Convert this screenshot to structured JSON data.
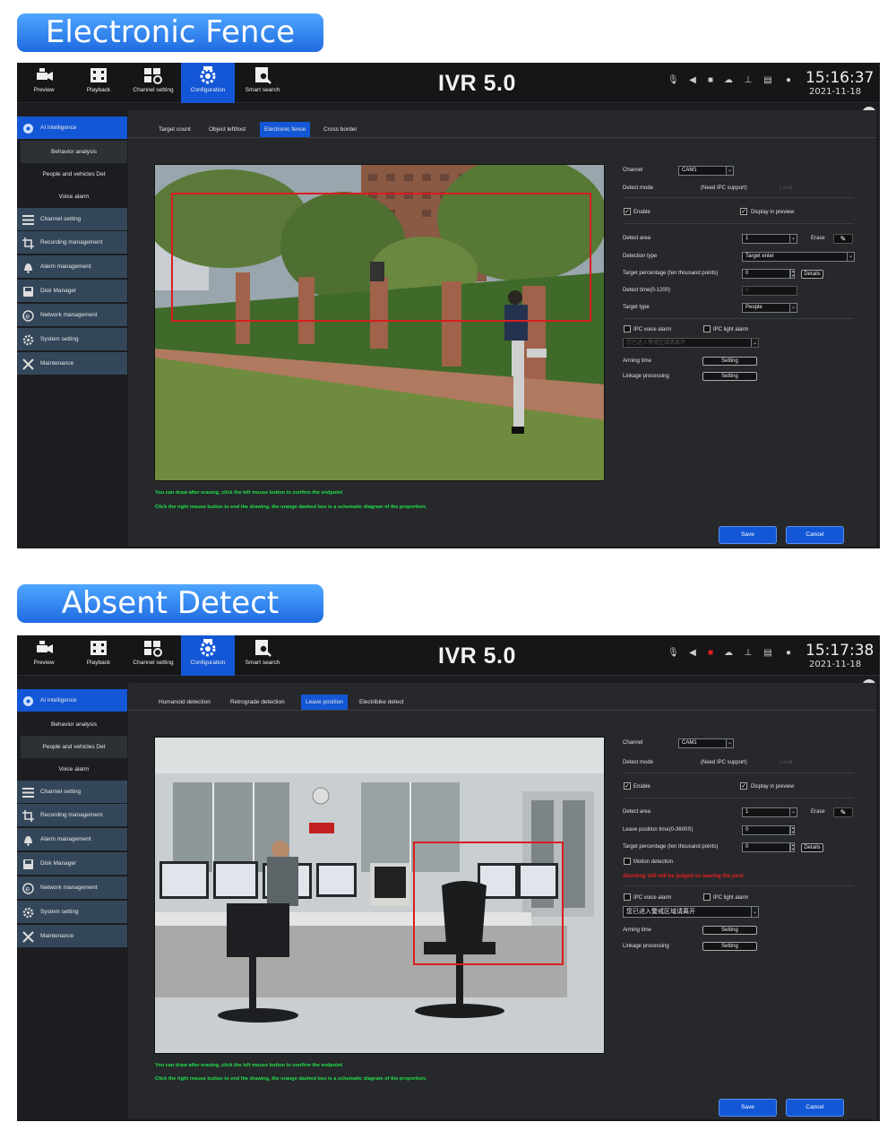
{
  "sections": [
    {
      "banner": "Electronic Fence",
      "nav": [
        {
          "label": "Preview",
          "icon": "camera-icon"
        },
        {
          "label": "Playback",
          "icon": "film-icon"
        },
        {
          "label": "Channel setting",
          "icon": "channel-grid-icon"
        },
        {
          "label": "Configuration",
          "icon": "gear-camera-icon"
        },
        {
          "label": "Smart search",
          "icon": "smart-search-icon"
        }
      ],
      "app_title": "IVR 5.0",
      "time": "15:16:37",
      "date": "2021-11-18",
      "sidebar": {
        "ai": "AI intelligence",
        "subs": [
          "Behavior analysis",
          "People and vehicles Det",
          "Voice alarm"
        ],
        "items": [
          "Channel setting",
          "Recording management",
          "Alarm management",
          "Disk Manager",
          "Network management",
          "System setting",
          "Maintenance"
        ]
      },
      "tabs": [
        "Target count",
        "Object left/lost",
        "Electronic fence",
        "Cross border"
      ],
      "form": {
        "channel_label": "Channel",
        "channel_value": "CAM1",
        "detect_mode_label": "Detect mode",
        "detect_mode_value": "(Need IPC support)",
        "detect_mode_local": "Local",
        "enable": "Enable",
        "display_preview": "Display in preview",
        "detect_area_label": "Detect area",
        "detect_area_value": "1",
        "erase": "Erase",
        "detection_type_label": "Detection type",
        "detection_type_value": "Target enter",
        "target_pct_label": "Target percentage (ten thousand points)",
        "target_pct_value": "0",
        "details": "Details",
        "detect_time_label": "Detect time(0-1200)",
        "detect_time_value": "0",
        "target_type_label": "Target type",
        "target_type_value": "People",
        "ipc_voice": "IPC voice alarm",
        "ipc_light": "IPC light alarm",
        "voice_text": "您已进入警戒区域请离开",
        "arming_label": "Arming time",
        "arming_btn": "Setting",
        "linkage_label": "Linkage processing",
        "linkage_btn": "Setting"
      },
      "tips": [
        "You can draw after erasing, click the left mouse button to confirm the endpoint",
        "Click the right mouse button to end the drawing, the orange dashed box is a schematic diagram of the proportion;"
      ],
      "save": "Save",
      "cancel": "Cancel"
    },
    {
      "banner": "Absent Detect",
      "app_title": "IVR 5.0",
      "time": "15:17:38",
      "date": "2021-11-18",
      "tabs": [
        "Humanoid detection",
        "Retrograde detection",
        "Leave position",
        "Electribike detect"
      ],
      "form": {
        "channel_label": "Channel",
        "channel_value": "CAM1",
        "detect_mode_label": "Detect mode",
        "detect_mode_value": "(Need IPC support)",
        "detect_mode_local": "Local",
        "enable": "Enable",
        "display_preview": "Display in preview",
        "detect_area_label": "Detect area",
        "detect_area_value": "1",
        "erase": "Erase",
        "leave_time_label": "Leave position time(0-3600S)",
        "leave_time_value": "0",
        "target_pct_label": "Target percentage (ten thousand points)",
        "target_pct_value": "0",
        "details": "Details",
        "motion_label": "Motion detection",
        "warning": "Standing still will be judged as leaving the post",
        "ipc_voice": "IPC voice alarm",
        "ipc_light": "IPC light alarm",
        "voice_text": "您已进入警戒区域请离开",
        "arming_label": "Arming time",
        "arming_btn": "Setting",
        "linkage_label": "Linkage processing",
        "linkage_btn": "Setting"
      },
      "tips": [
        "You can draw after erasing, click the left mouse button to confirm the endpoint",
        "Click the right mouse button to end the drawing, the orange dashed box is a schematic diagram of the proportion;"
      ],
      "save": "Save",
      "cancel": "Cancel"
    }
  ],
  "colors": {
    "accent": "#1457d6",
    "tip_green": "#22e04a",
    "warning_red": "#e02020",
    "zone_red": "#d81e1e",
    "sidebar": "#34475a"
  }
}
